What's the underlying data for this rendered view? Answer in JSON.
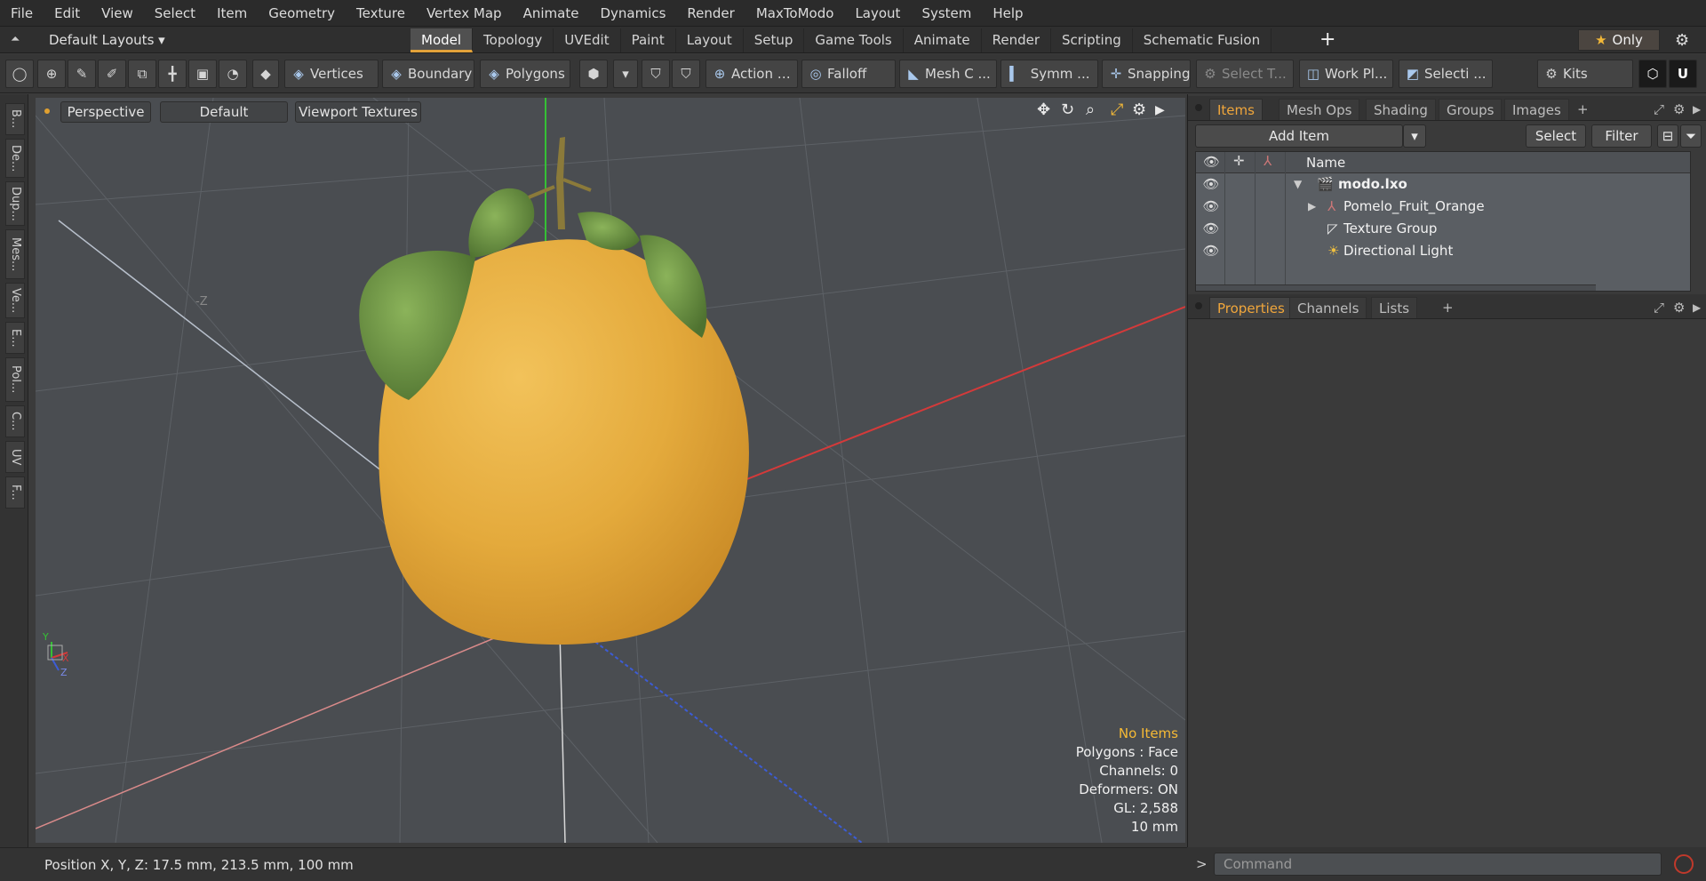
{
  "menu": [
    "File",
    "Edit",
    "View",
    "Select",
    "Item",
    "Geometry",
    "Texture",
    "Vertex Map",
    "Animate",
    "Dynamics",
    "Render",
    "MaxToModo",
    "Layout",
    "System",
    "Help"
  ],
  "layout_bar": {
    "layouts_label": "Default Layouts ▾",
    "tabs": [
      "Model",
      "Topology",
      "UVEdit",
      "Paint",
      "Layout",
      "Setup",
      "Game Tools",
      "Animate",
      "Render",
      "Scripting",
      "Schematic Fusion"
    ],
    "active_tab": "Model",
    "only_label": "Only"
  },
  "toolbar": {
    "vertices": "Vertices",
    "boundary": "Boundary",
    "polygons": "Polygons",
    "action": "Action",
    "falloff": "Falloff",
    "mesh": "Mesh C ...",
    "symm": "Symm ...",
    "snapping": "Snapping",
    "select_t": "Select T...",
    "work_plane": "Work Pl...",
    "selection": "Selecti ...",
    "kits": "Kits"
  },
  "left_tabs": [
    "B...",
    "De...",
    "Dup...",
    "Mes...",
    "Ve...",
    "E...",
    "Pol...",
    "C...",
    "UV",
    "F..."
  ],
  "viewport": {
    "view_label": "Perspective",
    "shading_label": "Default",
    "texture_label": "Viewport Textures",
    "axis_label": "-Z",
    "hud": {
      "selection": "No Items",
      "polygons": "Polygons : Face",
      "channels": "Channels: 0",
      "deformers": "Deformers: ON",
      "gl": "GL: 2,588",
      "scale": "10 mm"
    }
  },
  "items_panel": {
    "tabs": [
      "Items",
      "Mesh Ops",
      "Shading",
      "Groups",
      "Images"
    ],
    "add_item": "Add Item",
    "select": "Select",
    "filter": "Filter",
    "column_name": "Name",
    "rows": [
      {
        "label": "modo.lxo",
        "icon": "scene-icon"
      },
      {
        "label": "Pomelo_Fruit_Orange",
        "icon": "mesh-locator-icon"
      },
      {
        "label": "Texture Group",
        "icon": "folder-icon"
      },
      {
        "label": "Directional Light",
        "icon": "light-icon"
      }
    ]
  },
  "properties_panel": {
    "tabs": [
      "Properties",
      "Channels",
      "Lists"
    ]
  },
  "command": {
    "placeholder": "Command"
  },
  "status": {
    "position": "Position X, Y, Z:   17.5 mm, 213.5 mm, 100 mm"
  },
  "colors": {
    "accent": "#f0a63b",
    "fruit": "#e8ad3e",
    "leaf": "#6a8f3e",
    "x_axis": "#d43a3a",
    "y_axis": "#35c035",
    "z_axis": "#3c5cd6"
  }
}
